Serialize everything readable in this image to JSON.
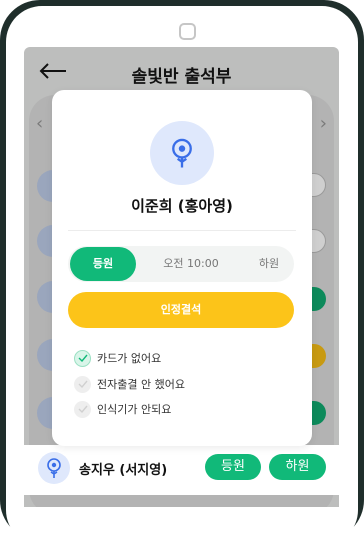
{
  "header": {
    "title": "솔빛반 출석부",
    "back_icon": "arrow-left-icon"
  },
  "background": {
    "rows": [
      {
        "status_color": "#d2d2d2"
      },
      {
        "status_color": "#d2d2d2"
      },
      {
        "status_color": "#11b979"
      },
      {
        "status_color": "#fcc419"
      },
      {
        "status_color": "#11b979"
      }
    ],
    "last_row": {
      "name": "송지우 (서지영)",
      "btn_arrive": "등원",
      "btn_leave": "하원"
    }
  },
  "modal": {
    "name": "이준희 (홍아영)",
    "segment": {
      "arrive": "등원",
      "time": "오전 10:00",
      "leave": "하원"
    },
    "absence_button": "인정결석",
    "options": [
      {
        "label": "카드가 없어요",
        "checked": true
      },
      {
        "label": "전자출결 안 했어요",
        "checked": false
      },
      {
        "label": "인식기가 안되요",
        "checked": false
      }
    ]
  },
  "colors": {
    "primary": "#11b979",
    "accent": "#fcc419",
    "avatar_bg": "#dfe8fc",
    "icon": "#3a6ee8"
  }
}
